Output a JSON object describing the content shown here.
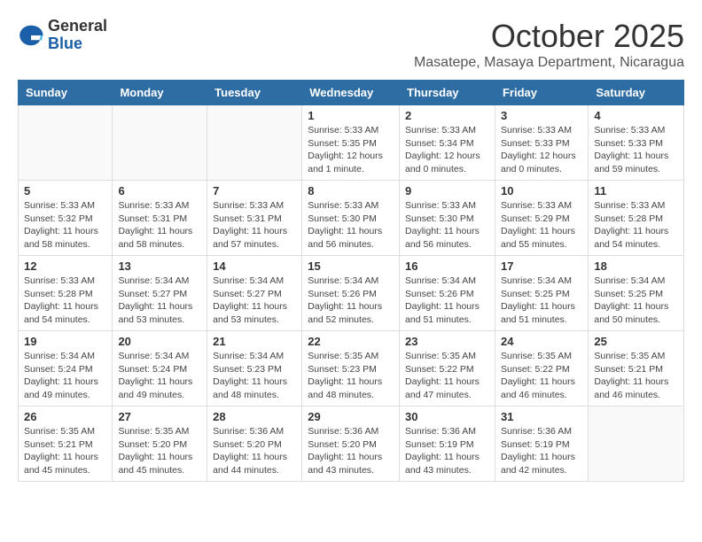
{
  "header": {
    "logo_general": "General",
    "logo_blue": "Blue",
    "month_title": "October 2025",
    "location": "Masatepe, Masaya Department, Nicaragua"
  },
  "weekdays": [
    "Sunday",
    "Monday",
    "Tuesday",
    "Wednesday",
    "Thursday",
    "Friday",
    "Saturday"
  ],
  "weeks": [
    [
      {
        "day": "",
        "info": ""
      },
      {
        "day": "",
        "info": ""
      },
      {
        "day": "",
        "info": ""
      },
      {
        "day": "1",
        "info": "Sunrise: 5:33 AM\nSunset: 5:35 PM\nDaylight: 12 hours\nand 1 minute."
      },
      {
        "day": "2",
        "info": "Sunrise: 5:33 AM\nSunset: 5:34 PM\nDaylight: 12 hours\nand 0 minutes."
      },
      {
        "day": "3",
        "info": "Sunrise: 5:33 AM\nSunset: 5:33 PM\nDaylight: 12 hours\nand 0 minutes."
      },
      {
        "day": "4",
        "info": "Sunrise: 5:33 AM\nSunset: 5:33 PM\nDaylight: 11 hours\nand 59 minutes."
      }
    ],
    [
      {
        "day": "5",
        "info": "Sunrise: 5:33 AM\nSunset: 5:32 PM\nDaylight: 11 hours\nand 58 minutes."
      },
      {
        "day": "6",
        "info": "Sunrise: 5:33 AM\nSunset: 5:31 PM\nDaylight: 11 hours\nand 58 minutes."
      },
      {
        "day": "7",
        "info": "Sunrise: 5:33 AM\nSunset: 5:31 PM\nDaylight: 11 hours\nand 57 minutes."
      },
      {
        "day": "8",
        "info": "Sunrise: 5:33 AM\nSunset: 5:30 PM\nDaylight: 11 hours\nand 56 minutes."
      },
      {
        "day": "9",
        "info": "Sunrise: 5:33 AM\nSunset: 5:30 PM\nDaylight: 11 hours\nand 56 minutes."
      },
      {
        "day": "10",
        "info": "Sunrise: 5:33 AM\nSunset: 5:29 PM\nDaylight: 11 hours\nand 55 minutes."
      },
      {
        "day": "11",
        "info": "Sunrise: 5:33 AM\nSunset: 5:28 PM\nDaylight: 11 hours\nand 54 minutes."
      }
    ],
    [
      {
        "day": "12",
        "info": "Sunrise: 5:33 AM\nSunset: 5:28 PM\nDaylight: 11 hours\nand 54 minutes."
      },
      {
        "day": "13",
        "info": "Sunrise: 5:34 AM\nSunset: 5:27 PM\nDaylight: 11 hours\nand 53 minutes."
      },
      {
        "day": "14",
        "info": "Sunrise: 5:34 AM\nSunset: 5:27 PM\nDaylight: 11 hours\nand 53 minutes."
      },
      {
        "day": "15",
        "info": "Sunrise: 5:34 AM\nSunset: 5:26 PM\nDaylight: 11 hours\nand 52 minutes."
      },
      {
        "day": "16",
        "info": "Sunrise: 5:34 AM\nSunset: 5:26 PM\nDaylight: 11 hours\nand 51 minutes."
      },
      {
        "day": "17",
        "info": "Sunrise: 5:34 AM\nSunset: 5:25 PM\nDaylight: 11 hours\nand 51 minutes."
      },
      {
        "day": "18",
        "info": "Sunrise: 5:34 AM\nSunset: 5:25 PM\nDaylight: 11 hours\nand 50 minutes."
      }
    ],
    [
      {
        "day": "19",
        "info": "Sunrise: 5:34 AM\nSunset: 5:24 PM\nDaylight: 11 hours\nand 49 minutes."
      },
      {
        "day": "20",
        "info": "Sunrise: 5:34 AM\nSunset: 5:24 PM\nDaylight: 11 hours\nand 49 minutes."
      },
      {
        "day": "21",
        "info": "Sunrise: 5:34 AM\nSunset: 5:23 PM\nDaylight: 11 hours\nand 48 minutes."
      },
      {
        "day": "22",
        "info": "Sunrise: 5:35 AM\nSunset: 5:23 PM\nDaylight: 11 hours\nand 48 minutes."
      },
      {
        "day": "23",
        "info": "Sunrise: 5:35 AM\nSunset: 5:22 PM\nDaylight: 11 hours\nand 47 minutes."
      },
      {
        "day": "24",
        "info": "Sunrise: 5:35 AM\nSunset: 5:22 PM\nDaylight: 11 hours\nand 46 minutes."
      },
      {
        "day": "25",
        "info": "Sunrise: 5:35 AM\nSunset: 5:21 PM\nDaylight: 11 hours\nand 46 minutes."
      }
    ],
    [
      {
        "day": "26",
        "info": "Sunrise: 5:35 AM\nSunset: 5:21 PM\nDaylight: 11 hours\nand 45 minutes."
      },
      {
        "day": "27",
        "info": "Sunrise: 5:35 AM\nSunset: 5:20 PM\nDaylight: 11 hours\nand 45 minutes."
      },
      {
        "day": "28",
        "info": "Sunrise: 5:36 AM\nSunset: 5:20 PM\nDaylight: 11 hours\nand 44 minutes."
      },
      {
        "day": "29",
        "info": "Sunrise: 5:36 AM\nSunset: 5:20 PM\nDaylight: 11 hours\nand 43 minutes."
      },
      {
        "day": "30",
        "info": "Sunrise: 5:36 AM\nSunset: 5:19 PM\nDaylight: 11 hours\nand 43 minutes."
      },
      {
        "day": "31",
        "info": "Sunrise: 5:36 AM\nSunset: 5:19 PM\nDaylight: 11 hours\nand 42 minutes."
      },
      {
        "day": "",
        "info": ""
      }
    ]
  ]
}
